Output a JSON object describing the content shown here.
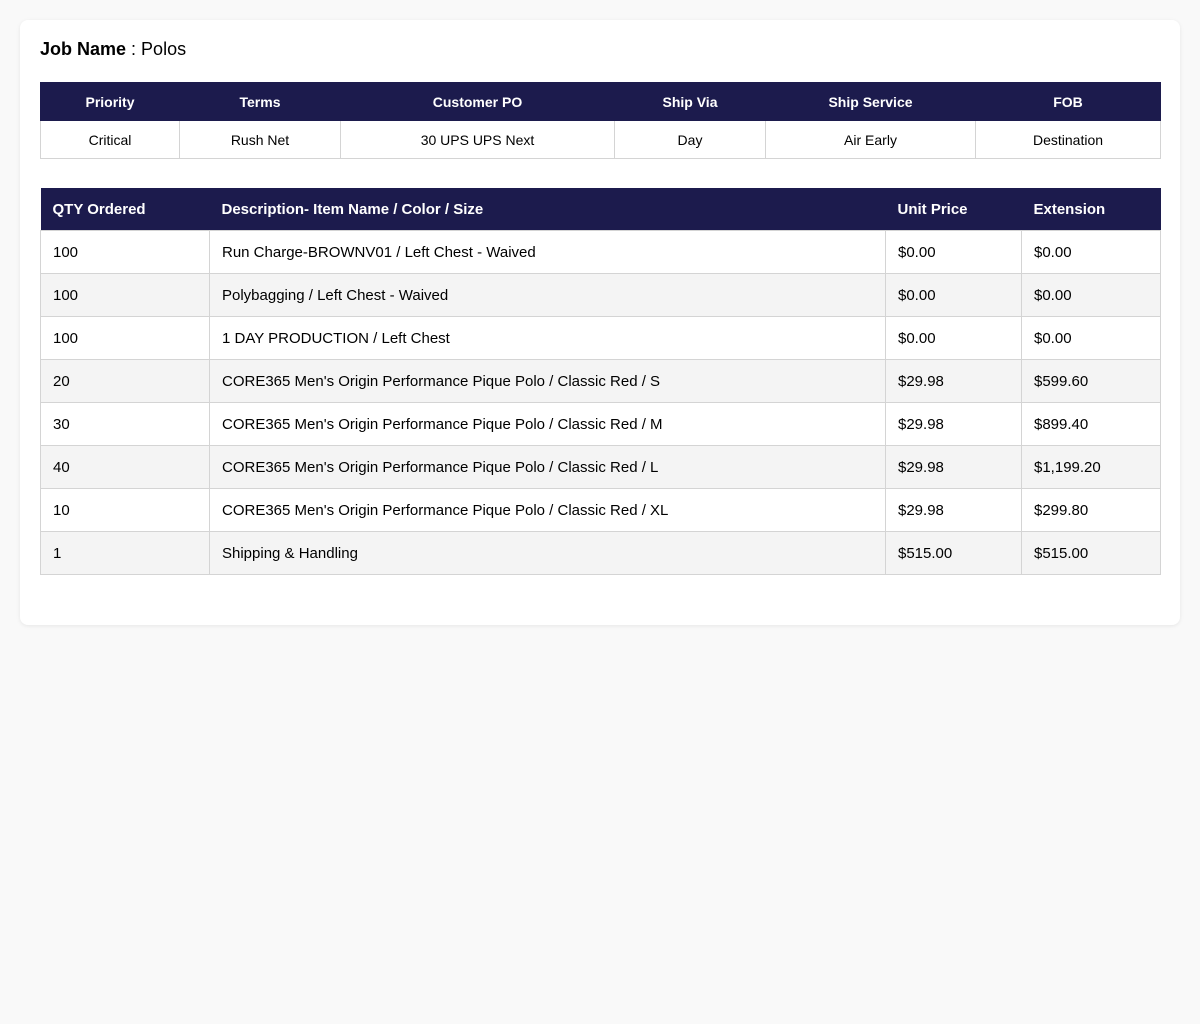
{
  "job": {
    "label": "Job Name",
    "separator": " : ",
    "value": "Polos"
  },
  "order_info": {
    "headers": [
      "Priority",
      "Terms",
      "Customer PO",
      "Ship Via",
      "Ship Service",
      "FOB"
    ],
    "values": [
      "Critical",
      "Rush Net",
      "30 UPS UPS Next",
      "Day",
      "Air Early",
      "Destination"
    ]
  },
  "line_items": {
    "headers": [
      "QTY Ordered",
      "Description- Item Name / Color / Size",
      "Unit Price",
      "Extension"
    ],
    "rows": [
      {
        "qty": "100",
        "description": "Run Charge-BROWNV01 / Left Chest - Waived",
        "unit_price": "$0.00",
        "extension": "$0.00"
      },
      {
        "qty": "100",
        "description": "Polybagging / Left Chest - Waived",
        "unit_price": "$0.00",
        "extension": "$0.00"
      },
      {
        "qty": "100",
        "description": "1 DAY PRODUCTION / Left Chest",
        "unit_price": "$0.00",
        "extension": "$0.00"
      },
      {
        "qty": "20",
        "description": "CORE365 Men's Origin Performance Pique Polo / Classic Red / S",
        "unit_price": "$29.98",
        "extension": "$599.60"
      },
      {
        "qty": "30",
        "description": "CORE365 Men's Origin Performance Pique Polo / Classic Red / M",
        "unit_price": "$29.98",
        "extension": "$899.40"
      },
      {
        "qty": "40",
        "description": "CORE365 Men's Origin Performance Pique Polo / Classic Red / L",
        "unit_price": "$29.98",
        "extension": "$1,199.20"
      },
      {
        "qty": "10",
        "description": "CORE365 Men's Origin Performance Pique Polo / Classic Red / XL",
        "unit_price": "$29.98",
        "extension": "$299.80"
      },
      {
        "qty": "1",
        "description": "Shipping & Handling",
        "unit_price": "$515.00",
        "extension": "$515.00"
      }
    ]
  },
  "colors": {
    "header_bg": "#1c1b4d",
    "header_text": "#ffffff",
    "row_alt_bg": "#f4f4f4",
    "border": "#d4d4d4"
  }
}
